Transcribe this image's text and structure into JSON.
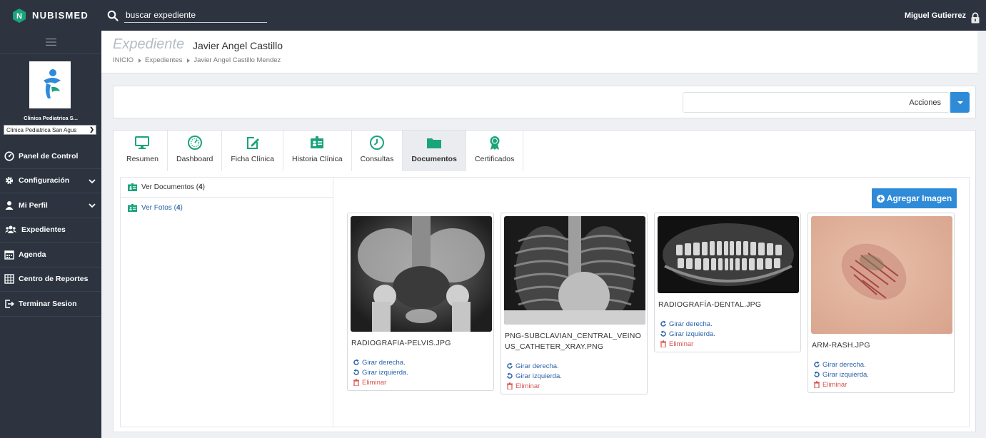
{
  "app": {
    "brand": "NUBISMED",
    "search": {
      "value": "buscar expediente",
      "placeholder": "buscar expediente"
    },
    "user_name": "Miguel Gutierrez"
  },
  "sidebar": {
    "clinic_name": "Clinica Pediatrica S...",
    "clinic_select_value": "Clinica Pediatrica San Agus",
    "items": [
      {
        "label": "Panel de Control",
        "icon": "dashboard-gauge-icon"
      },
      {
        "label": "Configuración",
        "icon": "gear-icon",
        "expandable": true
      },
      {
        "label": "Mi Perfil",
        "icon": "user-icon",
        "expandable": true
      },
      {
        "label": "Expedientes",
        "icon": "users-group-icon"
      },
      {
        "label": "Agenda",
        "icon": "calendar-icon"
      },
      {
        "label": "Centro de Reportes",
        "icon": "report-grid-icon"
      },
      {
        "label": "Terminar Sesion",
        "icon": "sign-out-icon"
      }
    ]
  },
  "header": {
    "title": "Expediente",
    "subtitle": "Javier Angel Castillo",
    "breadcrumb": [
      "INICIO",
      "Expedientes",
      "Javier Angel Castillo Mendez"
    ]
  },
  "actions": {
    "label": "Acciones"
  },
  "tabs": [
    {
      "label": "Resumen",
      "icon": "monitor-icon"
    },
    {
      "label": "Dashboard",
      "icon": "speedometer-icon"
    },
    {
      "label": "Ficha Clínica",
      "icon": "edit-form-icon"
    },
    {
      "label": "Historia Clínica",
      "icon": "id-card-icon"
    },
    {
      "label": "Consultas",
      "icon": "clock-check-icon"
    },
    {
      "label": "Documentos",
      "icon": "folder-icon",
      "active": true
    },
    {
      "label": "Certificados",
      "icon": "award-icon"
    }
  ],
  "documents": {
    "nav": [
      {
        "label": "Ver Documentos",
        "count": "4"
      },
      {
        "label": "Ver Fotos",
        "count": "4",
        "active": true
      }
    ],
    "add_button": "Agregar Imagen",
    "rotate_right": "Girar derecha.",
    "rotate_left": "Girar izquierda.",
    "delete": "Eliminar",
    "images": [
      {
        "filename": "RADIOGRAFIA-PELVIS.JPG",
        "kind": "pelvis-xray"
      },
      {
        "filename": "PNG-SUBCLAVIAN_CENTRAL_VEINOUS_CATHETER_XRAY.PNG",
        "kind": "chest-xray"
      },
      {
        "filename": "RADIOGRAFÍA-DENTAL.JPG",
        "kind": "dental-xray"
      },
      {
        "filename": "ARM-RASH.JPG",
        "kind": "arm-rash-photo"
      }
    ]
  },
  "colors": {
    "sidebar_bg": "#2d3440",
    "accent_blue": "#2f8bd8",
    "tab_icon_green": "#1aa47c",
    "link_blue": "#2a63a8",
    "delete_red": "#d9534f"
  }
}
